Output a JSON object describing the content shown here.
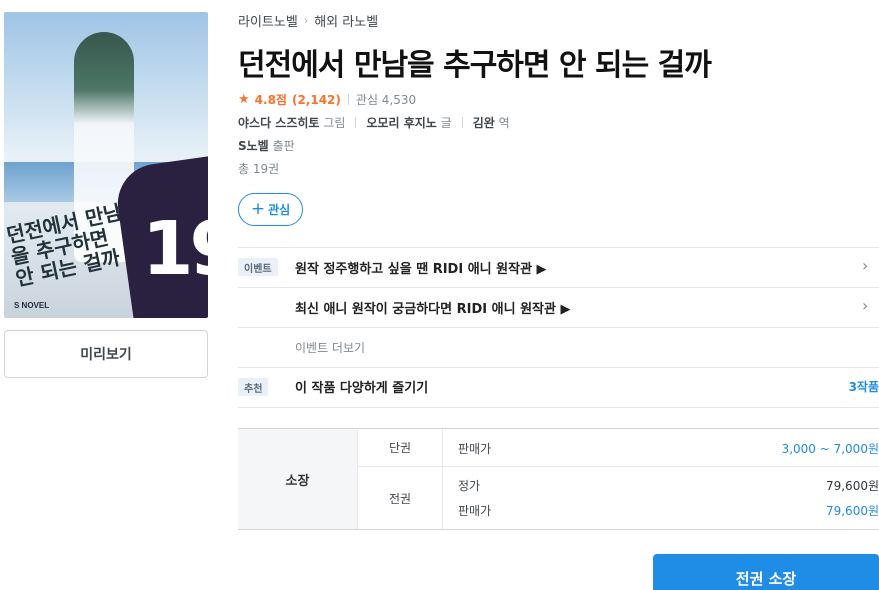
{
  "book": {
    "cover_alt": "던전에서 만남을 추구하면 안 되는 걸까 19권 표지",
    "cover_number": "19",
    "cover_publisher_mark": "S NOVEL",
    "title": "던전에서 만남을 추구하면 안 되는 걸까",
    "rating": "4.8점",
    "rating_count": "(2,142)",
    "interest": "관심 4,530",
    "authors": [
      {
        "name": "야스다 스즈히토",
        "role": "그림"
      },
      {
        "name": "오모리 후지노",
        "role": "글"
      },
      {
        "name": "김완",
        "role": "역"
      }
    ],
    "publisher": {
      "name": "S노벨",
      "role": "출판"
    },
    "total": "총 19권"
  },
  "breadcrumb": [
    "라이트노벨",
    "해외 라노벨"
  ],
  "buttons": {
    "preview": "미리보기",
    "wish": "관심",
    "buy_all": "전권 소장"
  },
  "events": {
    "badge": "이벤트",
    "items": [
      "원작 정주행하고 싶을 땐 RIDI 애니 원작관 ▶",
      "최신 애니 원작이 궁금하다면 RIDI 애니 원작관 ▶"
    ],
    "more": "이벤트 더보기"
  },
  "recommend": {
    "badge": "추천",
    "text": "이 작품 다양하게 즐기기",
    "count": "3작품"
  },
  "price": {
    "own_label": "소장",
    "single": {
      "type": "단권",
      "label": "판매가",
      "value": "3,000 ~ 7,000원"
    },
    "set": {
      "type": "전권",
      "list_label": "정가",
      "list_value": "79,600원",
      "sale_label": "판매가",
      "sale_value": "79,600원"
    }
  },
  "colors": {
    "accent": "#1f8ce6",
    "rating": "#fa722e"
  }
}
